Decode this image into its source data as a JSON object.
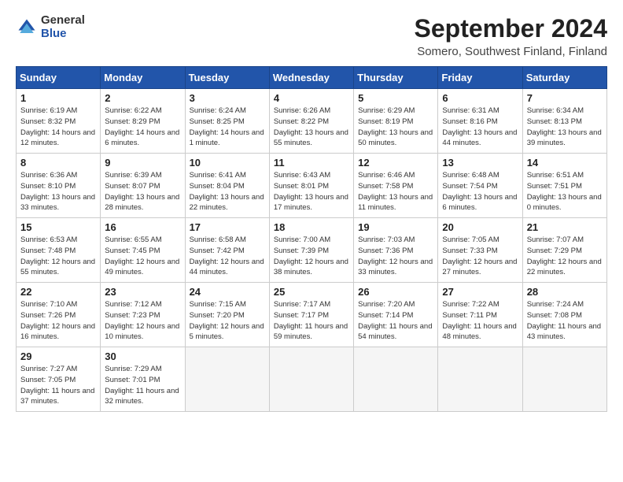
{
  "header": {
    "logo_general": "General",
    "logo_blue": "Blue",
    "title": "September 2024",
    "subtitle": "Somero, Southwest Finland, Finland"
  },
  "days_of_week": [
    "Sunday",
    "Monday",
    "Tuesday",
    "Wednesday",
    "Thursday",
    "Friday",
    "Saturday"
  ],
  "weeks": [
    [
      {
        "num": "1",
        "sunrise": "Sunrise: 6:19 AM",
        "sunset": "Sunset: 8:32 PM",
        "daylight": "Daylight: 14 hours and 12 minutes."
      },
      {
        "num": "2",
        "sunrise": "Sunrise: 6:22 AM",
        "sunset": "Sunset: 8:29 PM",
        "daylight": "Daylight: 14 hours and 6 minutes."
      },
      {
        "num": "3",
        "sunrise": "Sunrise: 6:24 AM",
        "sunset": "Sunset: 8:25 PM",
        "daylight": "Daylight: 14 hours and 1 minute."
      },
      {
        "num": "4",
        "sunrise": "Sunrise: 6:26 AM",
        "sunset": "Sunset: 8:22 PM",
        "daylight": "Daylight: 13 hours and 55 minutes."
      },
      {
        "num": "5",
        "sunrise": "Sunrise: 6:29 AM",
        "sunset": "Sunset: 8:19 PM",
        "daylight": "Daylight: 13 hours and 50 minutes."
      },
      {
        "num": "6",
        "sunrise": "Sunrise: 6:31 AM",
        "sunset": "Sunset: 8:16 PM",
        "daylight": "Daylight: 13 hours and 44 minutes."
      },
      {
        "num": "7",
        "sunrise": "Sunrise: 6:34 AM",
        "sunset": "Sunset: 8:13 PM",
        "daylight": "Daylight: 13 hours and 39 minutes."
      }
    ],
    [
      {
        "num": "8",
        "sunrise": "Sunrise: 6:36 AM",
        "sunset": "Sunset: 8:10 PM",
        "daylight": "Daylight: 13 hours and 33 minutes."
      },
      {
        "num": "9",
        "sunrise": "Sunrise: 6:39 AM",
        "sunset": "Sunset: 8:07 PM",
        "daylight": "Daylight: 13 hours and 28 minutes."
      },
      {
        "num": "10",
        "sunrise": "Sunrise: 6:41 AM",
        "sunset": "Sunset: 8:04 PM",
        "daylight": "Daylight: 13 hours and 22 minutes."
      },
      {
        "num": "11",
        "sunrise": "Sunrise: 6:43 AM",
        "sunset": "Sunset: 8:01 PM",
        "daylight": "Daylight: 13 hours and 17 minutes."
      },
      {
        "num": "12",
        "sunrise": "Sunrise: 6:46 AM",
        "sunset": "Sunset: 7:58 PM",
        "daylight": "Daylight: 13 hours and 11 minutes."
      },
      {
        "num": "13",
        "sunrise": "Sunrise: 6:48 AM",
        "sunset": "Sunset: 7:54 PM",
        "daylight": "Daylight: 13 hours and 6 minutes."
      },
      {
        "num": "14",
        "sunrise": "Sunrise: 6:51 AM",
        "sunset": "Sunset: 7:51 PM",
        "daylight": "Daylight: 13 hours and 0 minutes."
      }
    ],
    [
      {
        "num": "15",
        "sunrise": "Sunrise: 6:53 AM",
        "sunset": "Sunset: 7:48 PM",
        "daylight": "Daylight: 12 hours and 55 minutes."
      },
      {
        "num": "16",
        "sunrise": "Sunrise: 6:55 AM",
        "sunset": "Sunset: 7:45 PM",
        "daylight": "Daylight: 12 hours and 49 minutes."
      },
      {
        "num": "17",
        "sunrise": "Sunrise: 6:58 AM",
        "sunset": "Sunset: 7:42 PM",
        "daylight": "Daylight: 12 hours and 44 minutes."
      },
      {
        "num": "18",
        "sunrise": "Sunrise: 7:00 AM",
        "sunset": "Sunset: 7:39 PM",
        "daylight": "Daylight: 12 hours and 38 minutes."
      },
      {
        "num": "19",
        "sunrise": "Sunrise: 7:03 AM",
        "sunset": "Sunset: 7:36 PM",
        "daylight": "Daylight: 12 hours and 33 minutes."
      },
      {
        "num": "20",
        "sunrise": "Sunrise: 7:05 AM",
        "sunset": "Sunset: 7:33 PM",
        "daylight": "Daylight: 12 hours and 27 minutes."
      },
      {
        "num": "21",
        "sunrise": "Sunrise: 7:07 AM",
        "sunset": "Sunset: 7:29 PM",
        "daylight": "Daylight: 12 hours and 22 minutes."
      }
    ],
    [
      {
        "num": "22",
        "sunrise": "Sunrise: 7:10 AM",
        "sunset": "Sunset: 7:26 PM",
        "daylight": "Daylight: 12 hours and 16 minutes."
      },
      {
        "num": "23",
        "sunrise": "Sunrise: 7:12 AM",
        "sunset": "Sunset: 7:23 PM",
        "daylight": "Daylight: 12 hours and 10 minutes."
      },
      {
        "num": "24",
        "sunrise": "Sunrise: 7:15 AM",
        "sunset": "Sunset: 7:20 PM",
        "daylight": "Daylight: 12 hours and 5 minutes."
      },
      {
        "num": "25",
        "sunrise": "Sunrise: 7:17 AM",
        "sunset": "Sunset: 7:17 PM",
        "daylight": "Daylight: 11 hours and 59 minutes."
      },
      {
        "num": "26",
        "sunrise": "Sunrise: 7:20 AM",
        "sunset": "Sunset: 7:14 PM",
        "daylight": "Daylight: 11 hours and 54 minutes."
      },
      {
        "num": "27",
        "sunrise": "Sunrise: 7:22 AM",
        "sunset": "Sunset: 7:11 PM",
        "daylight": "Daylight: 11 hours and 48 minutes."
      },
      {
        "num": "28",
        "sunrise": "Sunrise: 7:24 AM",
        "sunset": "Sunset: 7:08 PM",
        "daylight": "Daylight: 11 hours and 43 minutes."
      }
    ],
    [
      {
        "num": "29",
        "sunrise": "Sunrise: 7:27 AM",
        "sunset": "Sunset: 7:05 PM",
        "daylight": "Daylight: 11 hours and 37 minutes."
      },
      {
        "num": "30",
        "sunrise": "Sunrise: 7:29 AM",
        "sunset": "Sunset: 7:01 PM",
        "daylight": "Daylight: 11 hours and 32 minutes."
      },
      null,
      null,
      null,
      null,
      null
    ]
  ]
}
